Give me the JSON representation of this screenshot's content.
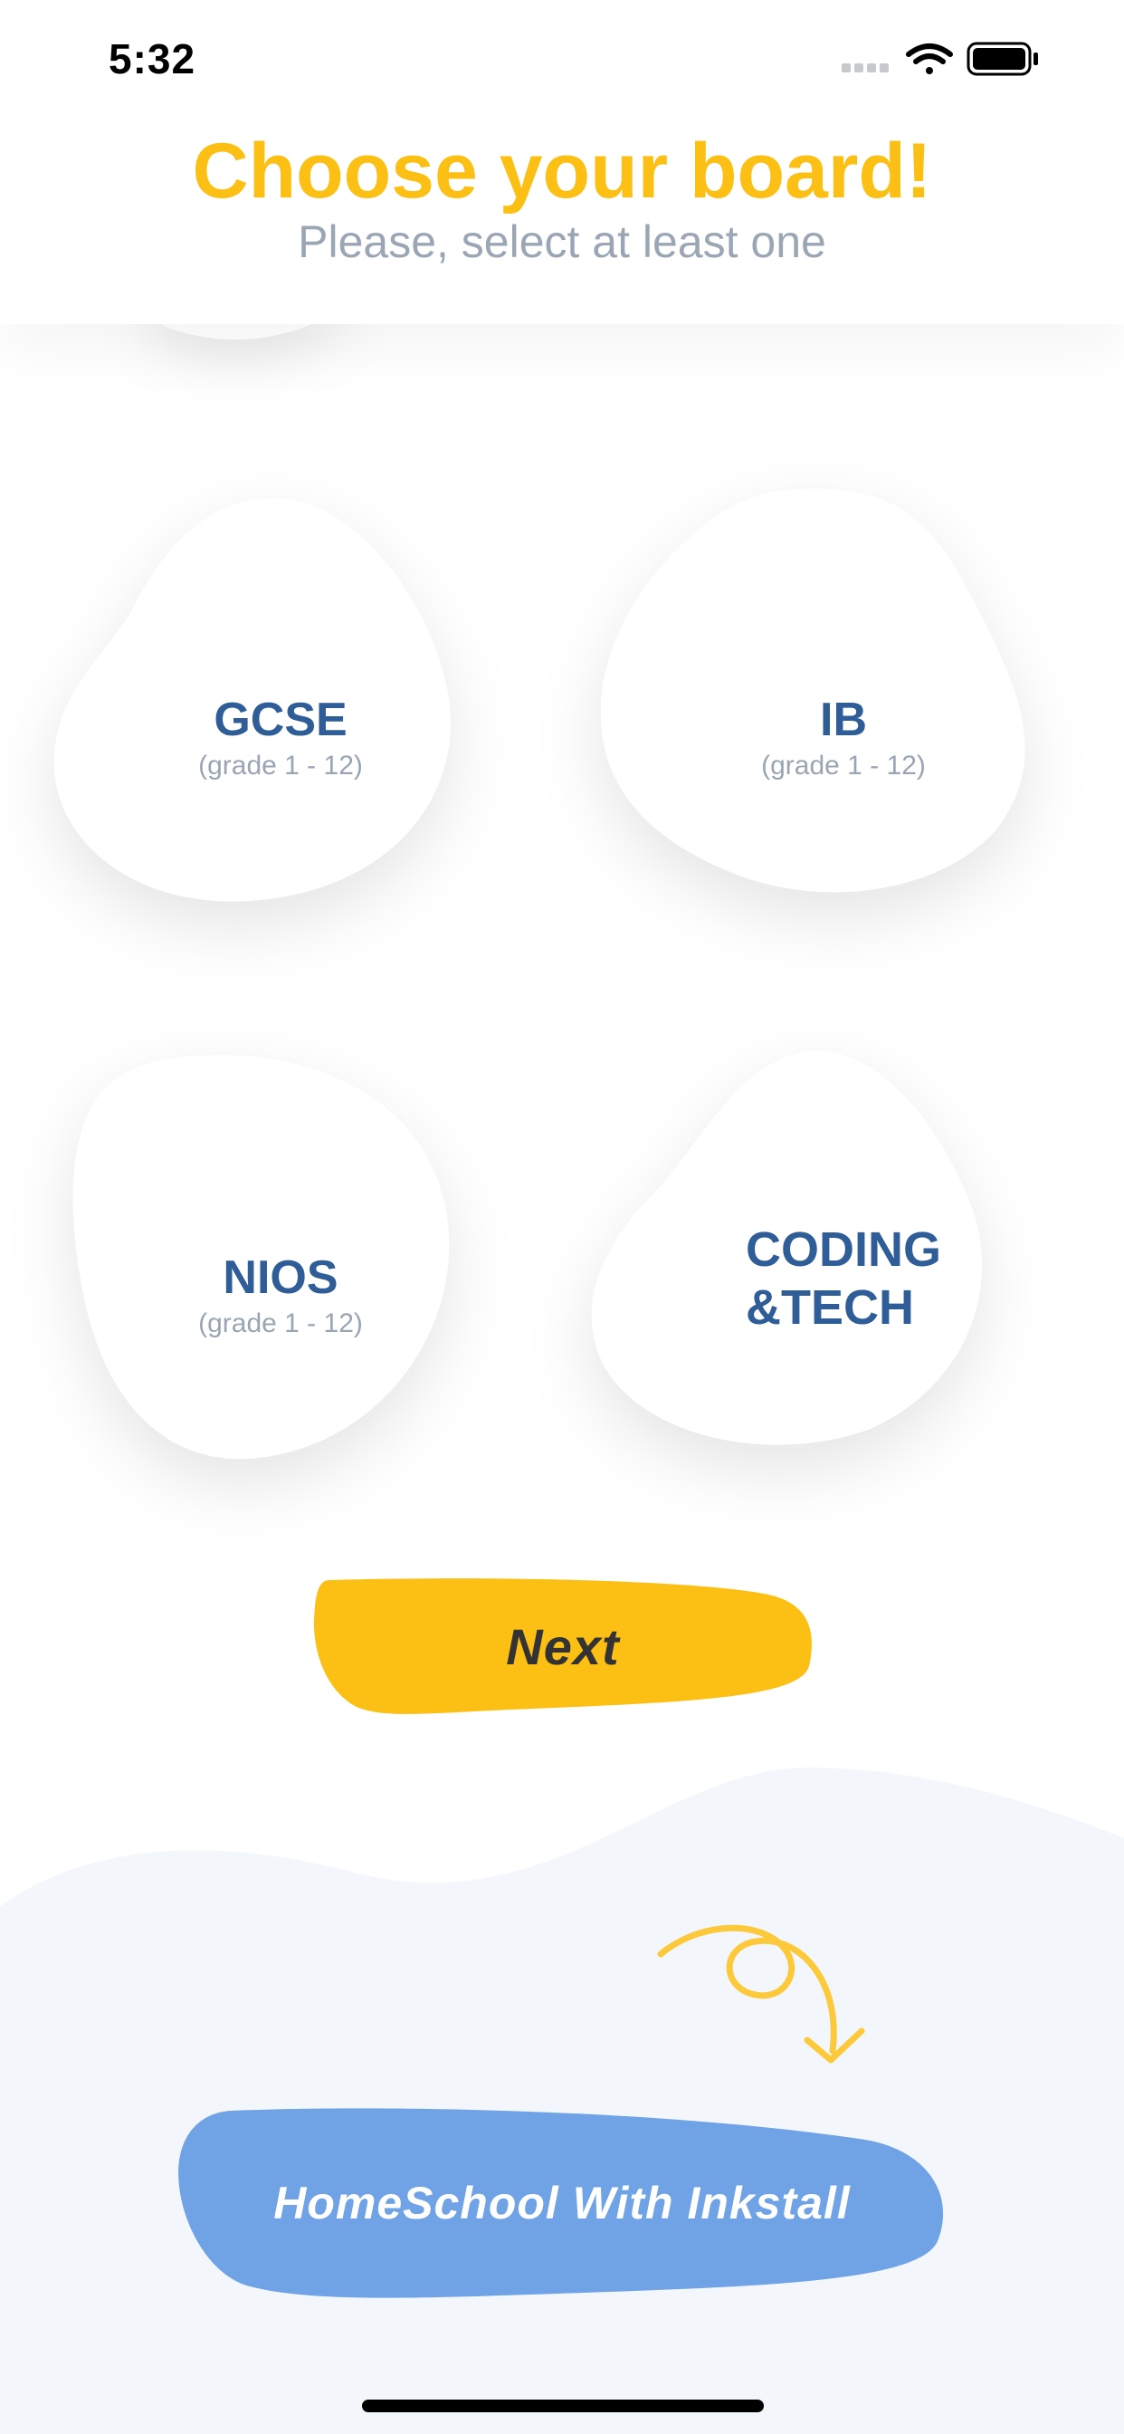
{
  "status_bar": {
    "time": "5:32"
  },
  "header": {
    "title": "Choose your board!",
    "subtitle": "Please, select at least one"
  },
  "boards": [
    {
      "name": "GCSE",
      "grade": "(grade 1 - 12)"
    },
    {
      "name": "IB",
      "grade": "(grade 1 - 12)"
    },
    {
      "name": "NIOS",
      "grade": "(grade 1 - 12)"
    },
    {
      "name_line1": "CODING",
      "name_line2": "&TECH"
    }
  ],
  "next_button": {
    "label": "Next"
  },
  "homeschool_button": {
    "label": "HomeSchool With Inkstall"
  },
  "colors": {
    "accent_yellow": "#fcbf14",
    "board_text": "#2f5d97",
    "muted_text": "#9aa5b4",
    "homeschool_blue": "#6fa3e6",
    "wave_bg": "#f3f7fc"
  },
  "icons": [
    "signal-icon",
    "wifi-icon",
    "battery-icon",
    "curly-arrow-icon"
  ]
}
